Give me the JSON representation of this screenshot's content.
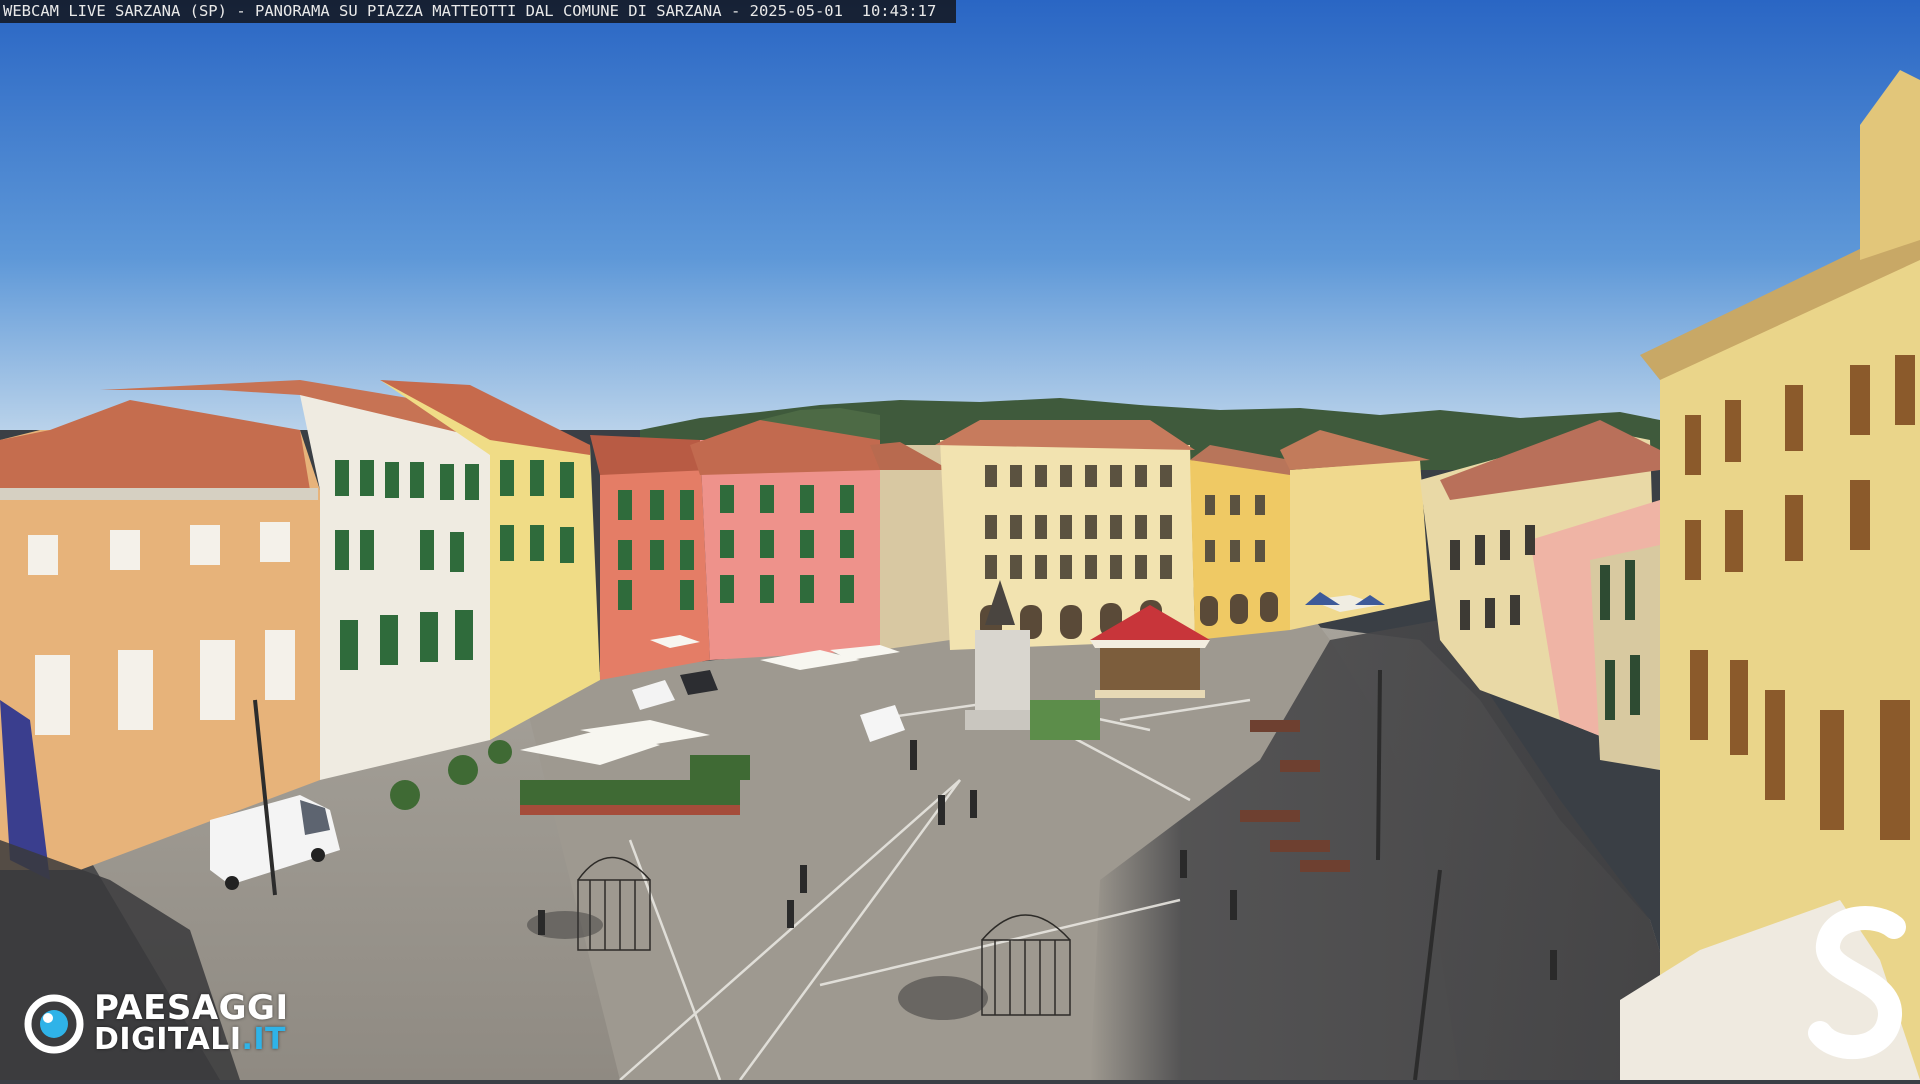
{
  "overlay": {
    "caption_parts": [
      "WEBCAM LIVE SARZANA (SP)",
      "-",
      "PANORAMA SU PIAZZA MATTEOTTI DAL COMUNE DI SARZANA",
      "-",
      "2025-05-01",
      "10:43:17"
    ]
  },
  "logo": {
    "line1": "PAESAGGI",
    "line2_main": "DIGITALI",
    "line2_tld": ".IT",
    "icon": "camera-lens-icon"
  },
  "corner_mark": {
    "icon": "s-letter-logo"
  },
  "colors": {
    "sky_top": "#2f6fc9",
    "sky_bottom": "#a9c8e6",
    "piazza": "#9c978f",
    "logo_accent": "#2fb3e8"
  }
}
